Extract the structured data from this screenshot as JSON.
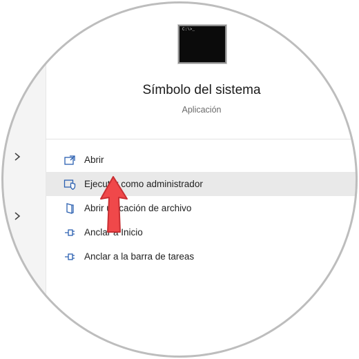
{
  "app": {
    "title": "Símbolo del sistema",
    "subtitle": "Aplicación",
    "icon": "command-prompt-icon",
    "tile_prompt": "C:\\>_"
  },
  "menu": {
    "items": [
      {
        "label": "Abrir",
        "icon": "open-window-icon"
      },
      {
        "label": "Ejecutar como administrador",
        "icon": "admin-shield-icon",
        "highlighted": true
      },
      {
        "label": "Abrir ubicación de archivo",
        "icon": "folder-location-icon"
      },
      {
        "label": "Anclar a Inicio",
        "icon": "pin-icon"
      },
      {
        "label": "Anclar a la barra de tareas",
        "icon": "pin-icon"
      }
    ]
  },
  "colors": {
    "accent": "#2a5fb0",
    "highlight": "#e9e9e9",
    "pointer_arrow": "#f0484a"
  }
}
